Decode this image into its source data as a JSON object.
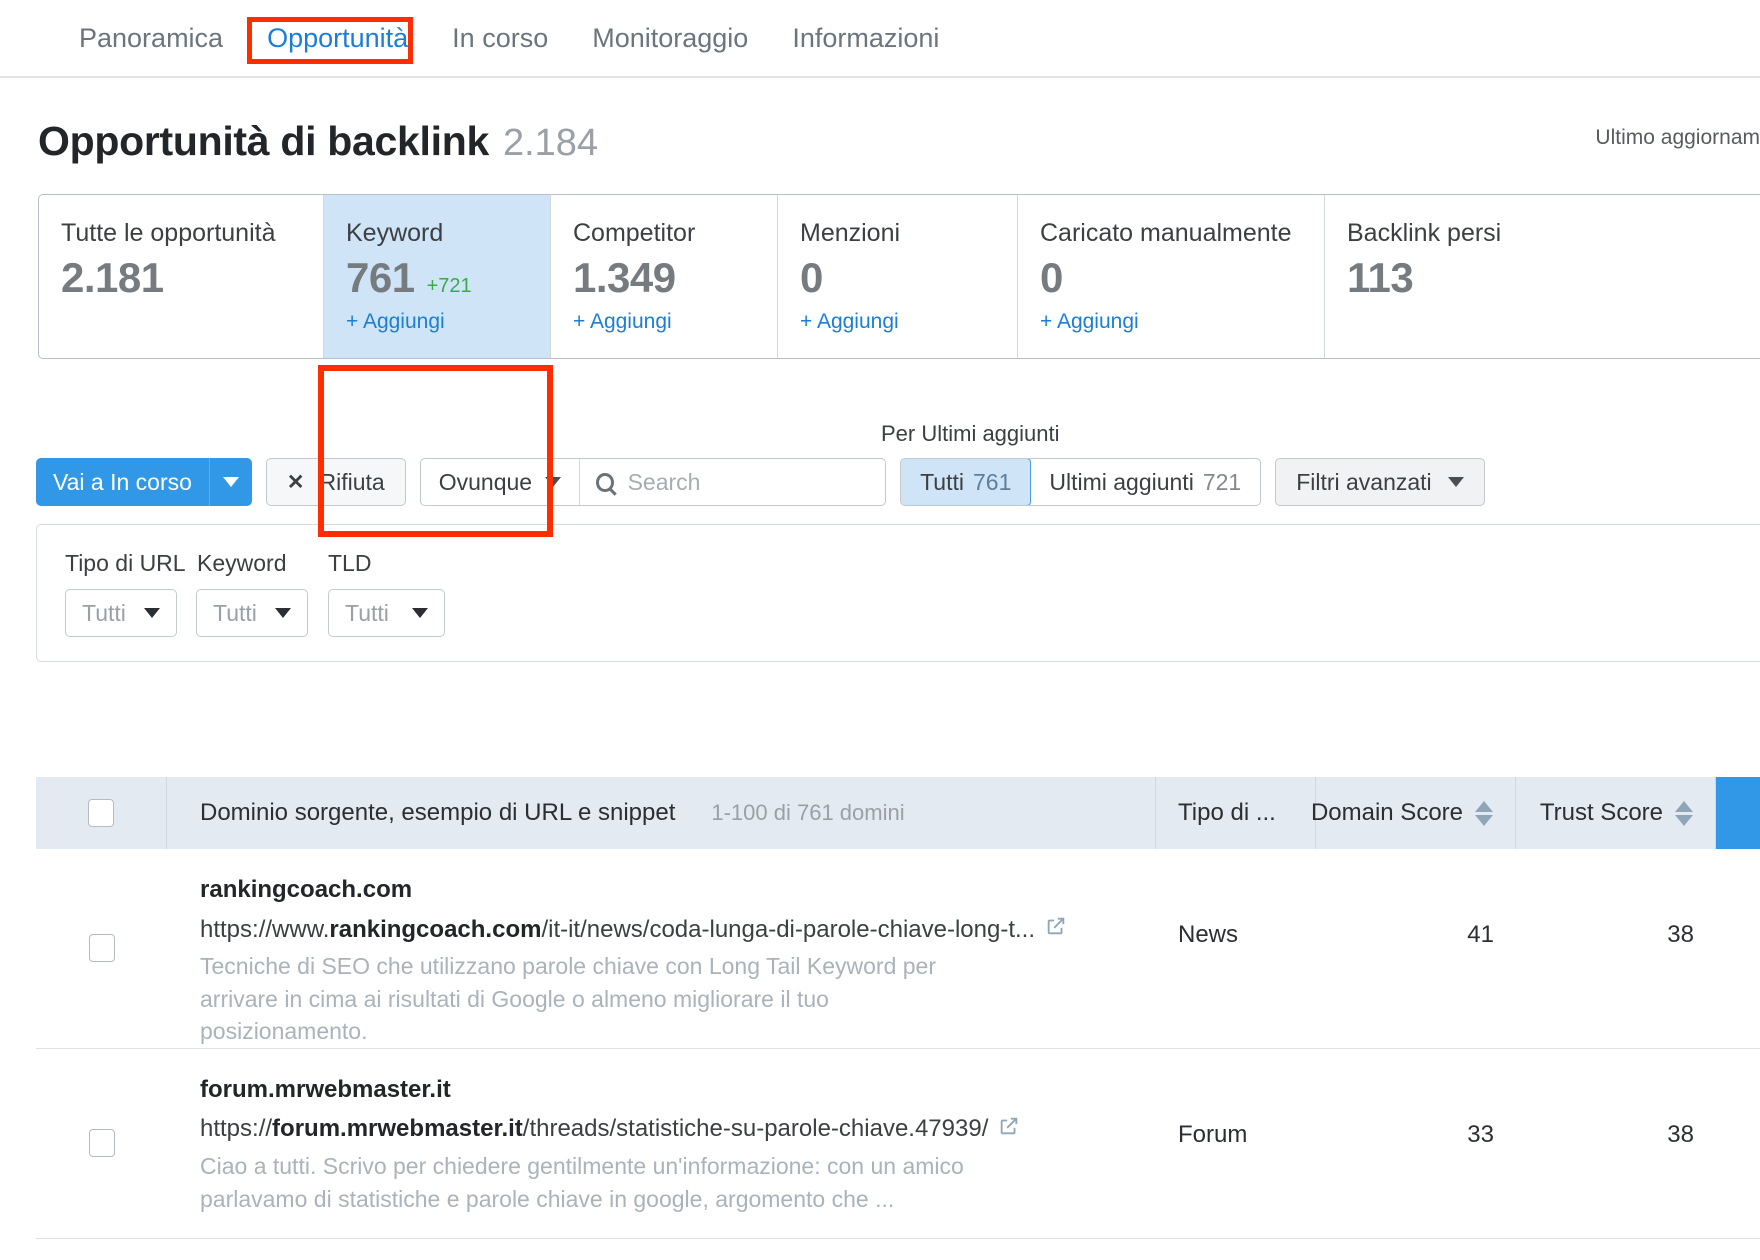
{
  "tabs": [
    {
      "label": "Panoramica",
      "active": false
    },
    {
      "label": "Opportunità",
      "active": true
    },
    {
      "label": "In corso",
      "active": false
    },
    {
      "label": "Monitoraggio",
      "active": false
    },
    {
      "label": "Informazioni",
      "active": false
    }
  ],
  "header": {
    "title": "Opportunità di backlink",
    "count": "2.184",
    "last_update": "Ultimo aggiornam"
  },
  "cards": [
    {
      "label": "Tutte le opportunità",
      "value": "2.181",
      "delta": "",
      "add": "",
      "selected": false
    },
    {
      "label": "Keyword",
      "value": "761",
      "delta": "+721",
      "add": "+ Aggiungi",
      "selected": true
    },
    {
      "label": "Competitor",
      "value": "1.349",
      "delta": "",
      "add": "+ Aggiungi",
      "selected": false
    },
    {
      "label": "Menzioni",
      "value": "0",
      "delta": "",
      "add": "+ Aggiungi",
      "selected": false
    },
    {
      "label": "Caricato manualmente",
      "value": "0",
      "delta": "",
      "add": "+ Aggiungi",
      "selected": false
    },
    {
      "label": "Backlink persi",
      "value": "113",
      "delta": "",
      "add": "",
      "selected": false
    }
  ],
  "toolbar": {
    "go_in_progress": "Vai a In corso",
    "reject": "Rifiuta",
    "scope": "Ovunque",
    "search_placeholder": "Search",
    "search_value": "",
    "sort_label": "Per Ultimi aggiunti",
    "seg_all_label": "Tutti",
    "seg_all_count": "761",
    "seg_recent_label": "Ultimi aggiunti",
    "seg_recent_count": "721",
    "advanced_filters": "Filtri avanzati"
  },
  "filters": [
    {
      "head": "Tipo di URL",
      "value": "Tutti"
    },
    {
      "head": "Keyword",
      "value": "Tutti"
    },
    {
      "head": "TLD",
      "value": "Tutti"
    }
  ],
  "table": {
    "header": {
      "main_title": "Dominio sorgente, esempio di URL e snippet",
      "main_sub": "1-100 di 761 domini",
      "col_type": "Tipo di ...",
      "col_domain_score": "Domain Score",
      "col_trust_score": "Trust Score"
    },
    "rows": [
      {
        "domain": "rankingcoach.com",
        "url_prefix": "https://www.",
        "url_bold": "rankingcoach.com",
        "url_suffix": "/it-it/news/coda-lunga-di-parole-chiave-long-t...",
        "snippet": "Tecniche di SEO che utilizzano parole chiave con Long Tail Keyword per arrivare in cima ai risultati di Google o almeno migliorare il tuo posizionamento.",
        "type": "News",
        "domain_score": "41",
        "trust_score": "38"
      },
      {
        "domain": "forum.mrwebmaster.it",
        "url_prefix": "https://",
        "url_bold": "forum.mrwebmaster.it",
        "url_suffix": "/threads/statistiche-su-parole-chiave.47939/",
        "snippet": "Ciao a tutti. Scrivo per chiedere gentilmente un'informazione: con un amico parlavamo di statistiche e parole chiave in google, argomento che ...",
        "type": "Forum",
        "domain_score": "33",
        "trust_score": "38"
      }
    ]
  },
  "colors": {
    "accent_blue": "#3198e8",
    "link_blue": "#1a7fd4",
    "annotation_red": "#ff2d00",
    "delta_green": "#3aab4b",
    "selected_bg": "#cfe4f7"
  }
}
